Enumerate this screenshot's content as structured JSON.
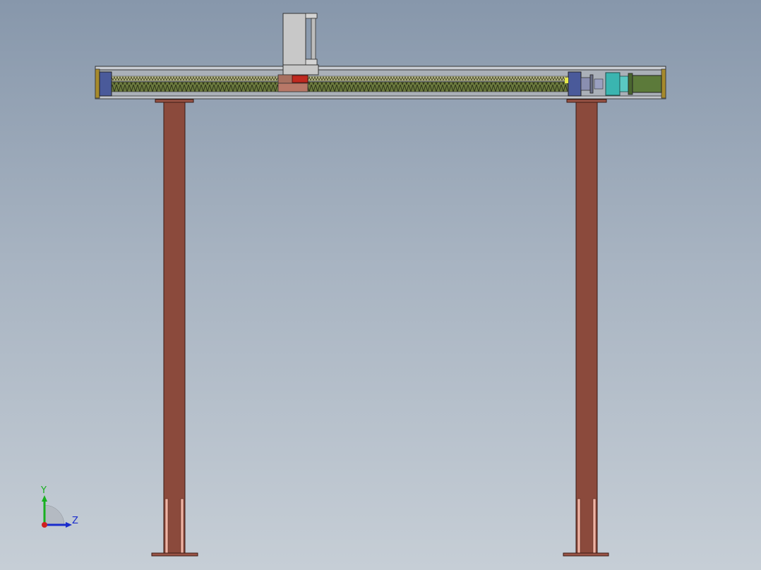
{
  "viewport": {
    "background_top": "#8797ab",
    "background_bottom": "#c6ced6"
  },
  "model": {
    "leg_color": "#8b4a3c",
    "leg_plate_color": "#9a5446",
    "leg_insert_color": "#f0b4a4",
    "beam_frame_color": "#c9cdd3",
    "rail_color": "#5f6e40",
    "bearing_block_color": "#4a5a9a",
    "end_cap_color": "#a68a2c",
    "carriage_color": "#c8c8c8",
    "carriage_red": "#c02a20",
    "coupling_color": "#3ab5b0",
    "motor_color": "#5c7a3a"
  },
  "triad": {
    "y_label": "Y",
    "z_label": "Z",
    "y_color": "#18b020",
    "z_color": "#1a2ccc",
    "x_color": "#d02020"
  }
}
